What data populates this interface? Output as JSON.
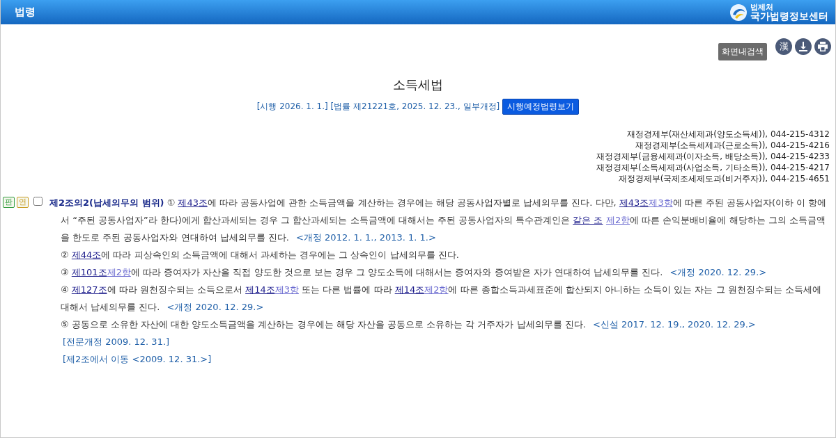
{
  "header": {
    "title": "법령",
    "logo_top": "법제처",
    "logo_main": "국가법령정보센터"
  },
  "toolbar": {
    "search_label": "화면내검색",
    "hanja_button": "漢"
  },
  "law": {
    "title": "소득세법",
    "info": "[시행 2026. 1. 1.] [법률 제21221호, 2025. 12. 23., 일부개정]",
    "future_button": "시행예정법령보기"
  },
  "contacts": [
    "재정경제부(재산세제과(양도소득세)), 044-215-4312",
    "재정경제부(소득세제과(근로소득)), 044-215-4216",
    "재정경제부(금융세제과(이자소득, 배당소득)), 044-215-4233",
    "재정경제부(소득세제과(사업소득, 기타소득)), 044-215-4217",
    "재정경제부(국제조세제도과(비거주자)), 044-215-4651"
  ],
  "article": {
    "badges": [
      {
        "label": "판",
        "color": "#2e9a3c"
      },
      {
        "label": "연",
        "color": "#c89a1e"
      }
    ],
    "checked": false,
    "paragraphs": [
      [
        {
          "kind": "heading",
          "text": "제2조의2(납세의무의 범위)"
        },
        {
          "kind": "text",
          "text": " ① "
        },
        {
          "kind": "link",
          "text": "제43조"
        },
        {
          "kind": "text",
          "text": "에 따라 공동사업에 관한 소득금액을 계산하는 경우에는 해당 공동사업자별로 납세의무를 진다. 다만, "
        },
        {
          "kind": "link",
          "text": "제43조"
        },
        {
          "kind": "sublink",
          "text": "제3항"
        },
        {
          "kind": "text",
          "text": "에 따른 주된 공동사업자(이하 이 항에서 “주된 공동사업자”라 한다)에게 합산과세되는 경우 그 합산과세되는 소득금액에 대해서는 주된 공동사업자의 특수관계인은 "
        },
        {
          "kind": "link",
          "text": "같은 조"
        },
        {
          "kind": "sublink",
          "text": "제2항",
          "space_before": true
        },
        {
          "kind": "text",
          "text": "에 따른 손익분배비율에 해당하는 그의 소득금액을 한도로 주된 공동사업자와 연대하여 납세의무를 진다. "
        },
        {
          "kind": "amend",
          "text": "<개정 2012. 1. 1., 2013. 1. 1.>"
        }
      ],
      [
        {
          "kind": "text",
          "text": "② "
        },
        {
          "kind": "link",
          "text": "제44조"
        },
        {
          "kind": "text",
          "text": "에 따라 피상속인의 소득금액에 대해서 과세하는 경우에는 그 상속인이 납세의무를 진다."
        }
      ],
      [
        {
          "kind": "text",
          "text": "③ "
        },
        {
          "kind": "link",
          "text": "제101조"
        },
        {
          "kind": "sublink",
          "text": "제2항"
        },
        {
          "kind": "text",
          "text": "에 따라 증여자가 자산을 직접 양도한 것으로 보는 경우 그 양도소득에 대해서는 증여자와 증여받은 자가 연대하여 납세의무를 진다. "
        },
        {
          "kind": "amend",
          "text": "<개정 2020. 12. 29.>"
        }
      ],
      [
        {
          "kind": "text",
          "text": "④ "
        },
        {
          "kind": "link",
          "text": "제127조"
        },
        {
          "kind": "text",
          "text": "에 따라 원천징수되는 소득으로서 "
        },
        {
          "kind": "link",
          "text": "제14조"
        },
        {
          "kind": "sublink",
          "text": "제3항"
        },
        {
          "kind": "text",
          "text": " 또는 다른 법률에 따라 "
        },
        {
          "kind": "link",
          "text": "제14조"
        },
        {
          "kind": "sublink",
          "text": "제2항"
        },
        {
          "kind": "text",
          "text": "에 따른 종합소득과세표준에 합산되지 아니하는 소득이 있는 자는 그 원천징수되는 소득세에 대해서 납세의무를 진다. "
        },
        {
          "kind": "amend",
          "text": "<개정 2020. 12. 29.>"
        }
      ],
      [
        {
          "kind": "text",
          "text": "⑤ 공동으로 소유한 자산에 대한 양도소득금액을 계산하는 경우에는 해당 자산을 공동으로 소유하는 각 거주자가 납세의무를 진다. "
        },
        {
          "kind": "amend",
          "text": "<신설 2017. 12. 19., 2020. 12. 29.>"
        }
      ]
    ],
    "notes": [
      "[전문개정 2009. 12. 31.]",
      "[제2조에서 이동 <2009. 12. 31.>]"
    ]
  }
}
